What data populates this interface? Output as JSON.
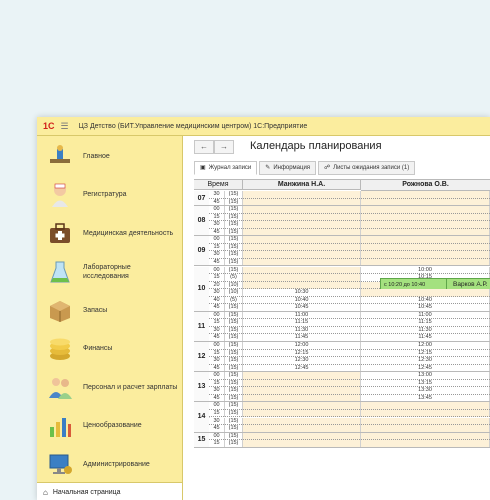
{
  "window": {
    "logo": "1С",
    "title": "ЦЗ Детство (БИТ.Управление медицинским центром) 1С:Предприятие"
  },
  "sidebar": {
    "items": [
      {
        "label": "Главное",
        "icon": "desk-icon"
      },
      {
        "label": "Регистратура",
        "icon": "nurse-icon"
      },
      {
        "label": "Медицинская деятельность",
        "icon": "medical-bag-icon"
      },
      {
        "label": "Лабораторные исследования",
        "icon": "lab-flask-icon"
      },
      {
        "label": "Запасы",
        "icon": "box-icon"
      },
      {
        "label": "Финансы",
        "icon": "coins-icon"
      },
      {
        "label": "Персонал и расчет зарплаты",
        "icon": "staff-icon"
      },
      {
        "label": "Ценообразование",
        "icon": "price-chart-icon"
      },
      {
        "label": "Администрирование",
        "icon": "admin-computer-icon"
      }
    ],
    "home": "Начальная страница"
  },
  "page": {
    "title": "Календарь планирования",
    "back": "←",
    "forward": "→",
    "tabs": [
      {
        "label": "Журнал записи",
        "active": true
      },
      {
        "label": "Информация",
        "active": false
      },
      {
        "label": "Листы ожидания записи (1)",
        "active": false
      }
    ]
  },
  "grid": {
    "time_header": "Время",
    "doctors": [
      "Манжина Н.А.",
      "Рожнова О.В."
    ],
    "hours": [
      {
        "hour": "07",
        "rows": [
          {
            "min": "30",
            "cnt": "(15)",
            "d1": "",
            "d2": ""
          },
          {
            "min": "45",
            "cnt": "(15)",
            "d1": "",
            "d2": ""
          }
        ]
      },
      {
        "hour": "08",
        "rows": [
          {
            "min": "00",
            "cnt": "(15)",
            "d1": "",
            "d2": ""
          },
          {
            "min": "15",
            "cnt": "(15)",
            "d1": "",
            "d2": ""
          },
          {
            "min": "30",
            "cnt": "(15)",
            "d1": "",
            "d2": ""
          },
          {
            "min": "45",
            "cnt": "(15)",
            "d1": "",
            "d2": ""
          }
        ]
      },
      {
        "hour": "09",
        "rows": [
          {
            "min": "00",
            "cnt": "(15)",
            "d1": "",
            "d2": ""
          },
          {
            "min": "15",
            "cnt": "(15)",
            "d1": "",
            "d2": ""
          },
          {
            "min": "30",
            "cnt": "(15)",
            "d1": "",
            "d2": ""
          },
          {
            "min": "45",
            "cnt": "(15)",
            "d1": "",
            "d2": ""
          }
        ]
      },
      {
        "hour": "10",
        "rows": [
          {
            "min": "00",
            "cnt": "(15)",
            "d1": "",
            "d2": "10:00"
          },
          {
            "min": "15",
            "cnt": "(5)",
            "d1": "",
            "d2": "10:15"
          },
          {
            "min": "20",
            "cnt": "(10)",
            "d1": "",
            "d2": ""
          },
          {
            "min": "30",
            "cnt": "(10)",
            "d1": "10:30",
            "d2": ""
          },
          {
            "min": "40",
            "cnt": "(5)",
            "d1": "10:40",
            "d2": "10:40"
          },
          {
            "min": "45",
            "cnt": "(15)",
            "d1": "10:45",
            "d2": "10:45"
          }
        ]
      },
      {
        "hour": "11",
        "rows": [
          {
            "min": "00",
            "cnt": "(15)",
            "d1": "11:00",
            "d2": "11:00"
          },
          {
            "min": "15",
            "cnt": "(15)",
            "d1": "11:15",
            "d2": "11:15"
          },
          {
            "min": "30",
            "cnt": "(15)",
            "d1": "11:30",
            "d2": "11:30"
          },
          {
            "min": "45",
            "cnt": "(15)",
            "d1": "11:45",
            "d2": "11:45"
          }
        ]
      },
      {
        "hour": "12",
        "rows": [
          {
            "min": "00",
            "cnt": "(15)",
            "d1": "12:00",
            "d2": "12:00"
          },
          {
            "min": "15",
            "cnt": "(15)",
            "d1": "12:15",
            "d2": "12:15"
          },
          {
            "min": "30",
            "cnt": "(15)",
            "d1": "12:30",
            "d2": "12:30"
          },
          {
            "min": "45",
            "cnt": "(15)",
            "d1": "12:45",
            "d2": "12:45"
          }
        ]
      },
      {
        "hour": "13",
        "rows": [
          {
            "min": "00",
            "cnt": "(15)",
            "d1": "",
            "d2": "13:00"
          },
          {
            "min": "15",
            "cnt": "(15)",
            "d1": "",
            "d2": "13:15"
          },
          {
            "min": "30",
            "cnt": "(15)",
            "d1": "",
            "d2": "13:30"
          },
          {
            "min": "45",
            "cnt": "(15)",
            "d1": "",
            "d2": "13:45"
          }
        ]
      },
      {
        "hour": "14",
        "rows": [
          {
            "min": "00",
            "cnt": "(15)",
            "d1": "",
            "d2": ""
          },
          {
            "min": "15",
            "cnt": "(15)",
            "d1": "",
            "d2": ""
          },
          {
            "min": "30",
            "cnt": "(15)",
            "d1": "",
            "d2": ""
          },
          {
            "min": "45",
            "cnt": "(15)",
            "d1": "",
            "d2": ""
          }
        ]
      },
      {
        "hour": "15",
        "rows": [
          {
            "min": "00",
            "cnt": "(15)",
            "d1": "",
            "d2": ""
          },
          {
            "min": "15",
            "cnt": "(15)",
            "d1": "",
            "d2": ""
          }
        ]
      }
    ],
    "appointment": {
      "time": "с 10:20 до 10:40",
      "patient": "Варков А.Р."
    }
  },
  "colors": {
    "sidebar_bg": "#fbed9e",
    "busy_cell": "#fdf1d8",
    "free_cell": "#ffffff",
    "appointment": "#a4e17f"
  }
}
